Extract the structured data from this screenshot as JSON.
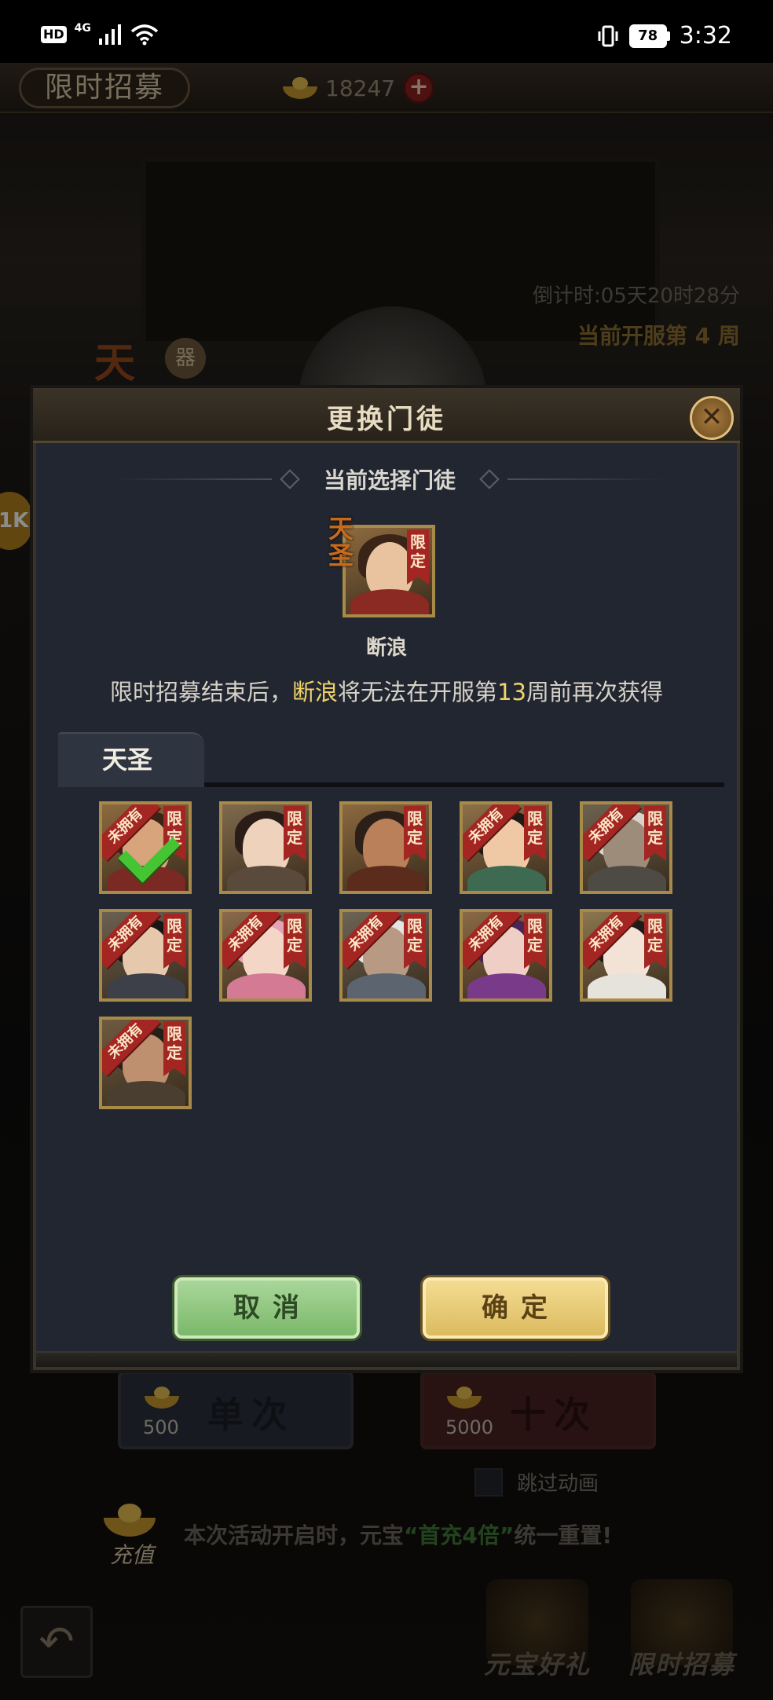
{
  "status_bar": {
    "hd": "HD",
    "network": "4G",
    "battery": "78",
    "time": "3:32"
  },
  "background": {
    "title": "限时招募",
    "currency_amount": "18247",
    "countdown": "倒计时:05天20时28分",
    "week_info": "当前开服第 4 周",
    "single_label": "单次",
    "single_cost": "500",
    "ten_label": "十次",
    "ten_cost": "5000",
    "skip_animation": "跳过动画",
    "recharge_label": "充值",
    "recharge_notice_prefix": "本次活动开启时，元宝",
    "recharge_notice_highlight": "“首充4倍”",
    "recharge_notice_suffix": "统一重置!",
    "nav_gift": "元宝好礼",
    "nav_recruit": "限时招募",
    "side_tag": "器",
    "side_badge": "1K",
    "side_text": "天"
  },
  "modal": {
    "title": "更换门徒",
    "section_title": "当前选择门徒",
    "current_hero_name": "断浪",
    "current_hero_grade": "天圣",
    "limited_label": "限定",
    "notice_prefix": "限时招募结束后，",
    "notice_name": "断浪",
    "notice_mid": "将无法在开服第",
    "notice_week": "13",
    "notice_suffix": "周前再次获得",
    "tab_label": "天圣",
    "unowned_label": "未拥有",
    "cancel_label": "取消",
    "confirm_label": "确定"
  },
  "heroes": [
    {
      "id": "hero-1",
      "unowned": true,
      "selected": true,
      "skin": "#d8a47c",
      "hair": "#3a2418",
      "cloth": "#7a2a22",
      "bg": "#8c6a3e"
    },
    {
      "id": "hero-2",
      "unowned": false,
      "selected": false,
      "skin": "#efd2bb",
      "hair": "#2a1d18",
      "cloth": "#5a4a3c",
      "bg": "#7f6a4c"
    },
    {
      "id": "hero-3",
      "unowned": false,
      "selected": false,
      "skin": "#b9805a",
      "hair": "#2b1f17",
      "cloth": "#5b2b1c",
      "bg": "#8b6940"
    },
    {
      "id": "hero-4",
      "unowned": true,
      "selected": false,
      "skin": "#efc9a6",
      "hair": "#1e1a16",
      "cloth": "#3f6a52",
      "bg": "#8c7048"
    },
    {
      "id": "hero-5",
      "unowned": true,
      "selected": false,
      "skin": "#9d8c7a",
      "hair": "#d8d4cc",
      "cloth": "#4e4a44",
      "bg": "#6c6250"
    },
    {
      "id": "hero-6",
      "unowned": true,
      "selected": false,
      "skin": "#e6c8ad",
      "hair": "#161616",
      "cloth": "#3d4048",
      "bg": "#6b6052"
    },
    {
      "id": "hero-7",
      "unowned": true,
      "selected": false,
      "skin": "#f3d6c6",
      "hair": "#e6a3b6",
      "cloth": "#d47a94",
      "bg": "#8a6a4a"
    },
    {
      "id": "hero-8",
      "unowned": true,
      "selected": false,
      "skin": "#b89a84",
      "hair": "#e4e4e4",
      "cloth": "#5c6470",
      "bg": "#6d6456"
    },
    {
      "id": "hero-9",
      "unowned": true,
      "selected": false,
      "skin": "#efcfc5",
      "hair": "#4a2456",
      "cloth": "#7a3a8a",
      "bg": "#8a6a46"
    },
    {
      "id": "hero-10",
      "unowned": true,
      "selected": false,
      "skin": "#f3e2d6",
      "hair": "#1f1b1a",
      "cloth": "#e6e2dc",
      "bg": "#8c7650"
    },
    {
      "id": "hero-11",
      "unowned": true,
      "selected": false,
      "skin": "#bf9070",
      "hair": "#222018",
      "cloth": "#4a3e30",
      "bg": "#6e5a40"
    }
  ],
  "current_hero": {
    "skin": "#e9c3a0",
    "hair": "#3a2418",
    "cloth": "#8a2a22",
    "bg": "#8c6a3e"
  }
}
